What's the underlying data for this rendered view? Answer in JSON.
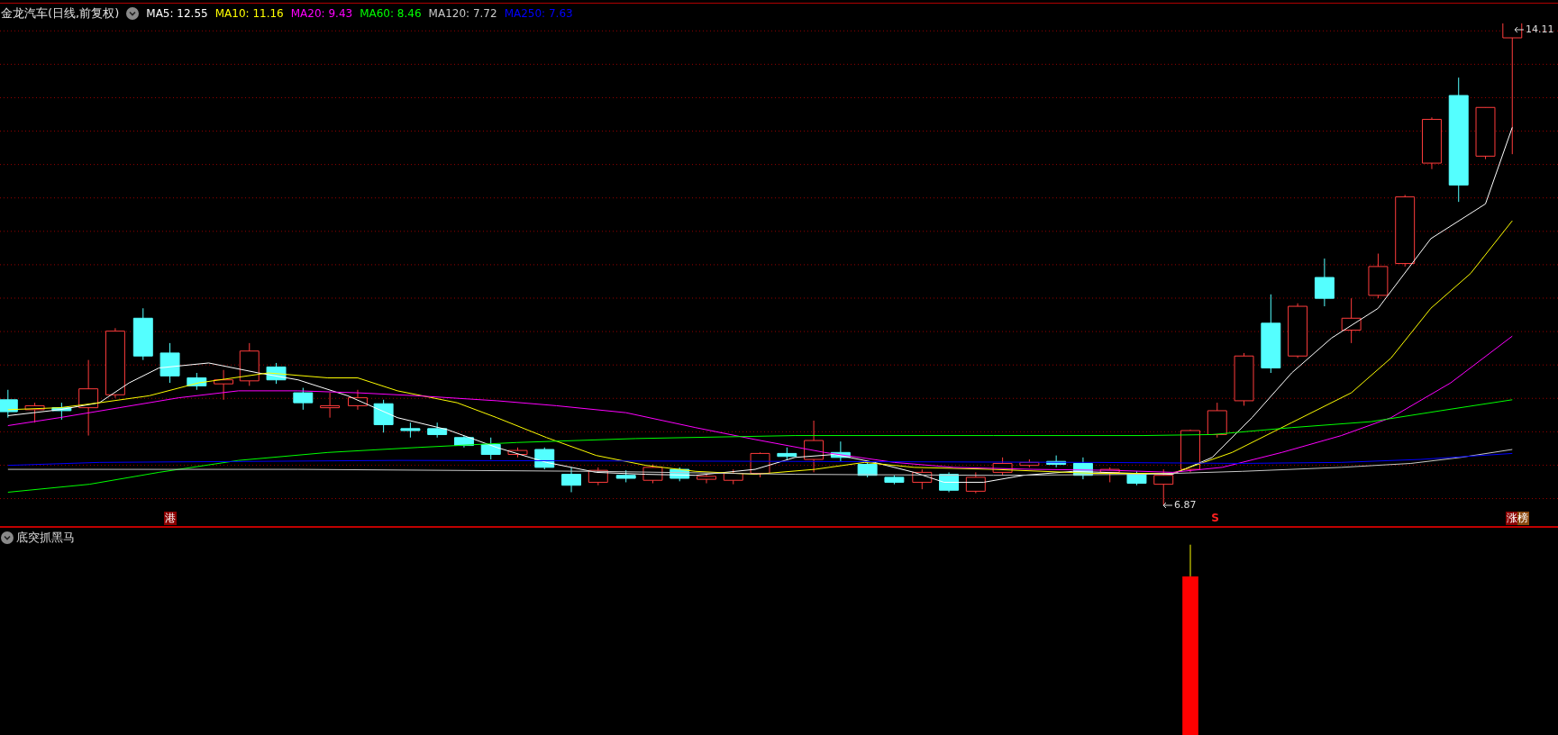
{
  "legend": {
    "title": "金龙汽车(日线,前复权)",
    "indicators": [
      {
        "label": "MA5: 12.55",
        "color": "#ffffff"
      },
      {
        "label": "MA10: 11.16",
        "color": "#ffff00"
      },
      {
        "label": "MA20: 9.43",
        "color": "#ff00ff"
      },
      {
        "label": "MA60: 8.46",
        "color": "#00ff00"
      },
      {
        "label": "MA120: 7.72",
        "color": "#c8c8c8"
      },
      {
        "label": "MA250: 7.63",
        "color": "#0000ff"
      }
    ]
  },
  "main_chart": {
    "high_label": "14.11",
    "low_label": "6.87",
    "markers": [
      {
        "text": "港",
        "kind": "tag"
      },
      {
        "text": "S",
        "kind": "signal"
      },
      {
        "text": "涨榜",
        "kind": "tag2"
      }
    ]
  },
  "indicator_panel": {
    "title": "底突抓黑马"
  }
}
